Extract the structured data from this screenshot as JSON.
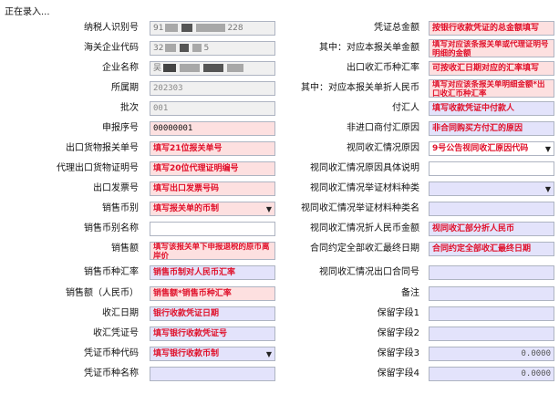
{
  "status": "正在录入...",
  "left": [
    {
      "label": "纳税人识别号",
      "v1": "91",
      "v2": "228"
    },
    {
      "label": "海关企业代码",
      "v1": "32",
      "v2": "5"
    },
    {
      "label": "企业名称",
      "v1": "吴"
    },
    {
      "label": "所属期",
      "value": "202303"
    },
    {
      "label": "批次",
      "value": "001"
    },
    {
      "label": "申报序号",
      "value": "00000001"
    },
    {
      "label": "出口货物报关单号",
      "hint": "填写21位报关单号"
    },
    {
      "label": "代理出口货物证明号",
      "hint": "填写20位代理证明编号"
    },
    {
      "label": "出口发票号",
      "hint": "填写出口发票号码"
    },
    {
      "label": "销售币别",
      "hint": "填写报关单的币制"
    },
    {
      "label": "销售币别名称",
      "value": ""
    },
    {
      "label": "销售额",
      "hint": "填写该报关单下申报退税的原币离岸价"
    },
    {
      "label": "销售币种汇率",
      "hint": "销售币制对人民币汇率"
    },
    {
      "label": "销售额（人民币）",
      "hint": "销售额*销售币种汇率"
    },
    {
      "label": "收汇日期",
      "hint": "银行收款凭证日期"
    },
    {
      "label": "收汇凭证号",
      "hint": "填写银行收款凭证号"
    },
    {
      "label": "凭证币种代码",
      "hint": "填写银行收款币制"
    },
    {
      "label": "凭证币种名称",
      "value": ""
    }
  ],
  "right": [
    {
      "label": "凭证总金额",
      "hint": "按银行收款凭证的总金额填写"
    },
    {
      "label": "其中：对应本报关单金额",
      "hint": "填写对应该条报关单或代理证明号明细的金额"
    },
    {
      "label": "出口收汇币种汇率",
      "hint": "可按收汇日期对应的汇率填写"
    },
    {
      "label": "其中：对应本报关单折人民币",
      "hint": "填写对应该条报关单明细金额*出口收汇币种汇率"
    },
    {
      "label": "付汇人",
      "hint": "填写收款凭证中付款人"
    },
    {
      "label": "非进口商付汇原因",
      "hint": "非合同购买方付汇的原因"
    },
    {
      "label": "视同收汇情况原因",
      "hint": "9号公告视同收汇原因代码"
    },
    {
      "label": "视同收汇情况原因具体说明",
      "value": ""
    },
    {
      "label": "视同收汇情况举证材料种类",
      "value": ""
    },
    {
      "label": "视同收汇情况举证材料种类名",
      "value": ""
    },
    {
      "label": "视同收汇情况折人民币金额",
      "hint": "视同收汇部分折人民币"
    },
    {
      "label": "合同约定全部收汇最终日期",
      "hint": "合同约定全部收汇最终日期"
    },
    {
      "label": "视同收汇情况出口合同号",
      "value": ""
    },
    {
      "label": "备注",
      "value": ""
    },
    {
      "label": "保留字段1",
      "value": ""
    },
    {
      "label": "保留字段2",
      "value": ""
    },
    {
      "label": "保留字段3",
      "value": "0.0000"
    },
    {
      "label": "保留字段4",
      "value": "0.0000"
    }
  ],
  "colors": {
    "pink": "#fde0e0",
    "lavender": "#e3e3fb",
    "readonly": "#f0f0f0",
    "hint_text": "#e0102a"
  }
}
